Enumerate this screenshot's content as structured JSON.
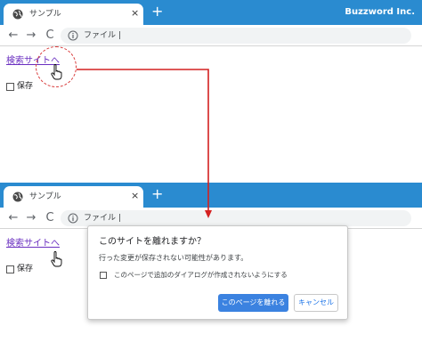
{
  "top_window": {
    "tab": {
      "title": "サンプル",
      "close": "×"
    },
    "new_tab": "+",
    "brand": "Buzzword Inc.",
    "toolbar": {
      "back": "←",
      "forward": "→",
      "reload": "C",
      "url": "ファイル |"
    },
    "content": {
      "search_link": "検索サイトへ",
      "checkbox_label": "保存"
    }
  },
  "bottom_window": {
    "tab": {
      "title": "サンプル",
      "close": "×"
    },
    "new_tab": "+",
    "toolbar": {
      "back": "←",
      "forward": "→",
      "reload": "C",
      "url": "ファイル |"
    },
    "content": {
      "search_link": "検索サイトへ",
      "checkbox_label": "保存"
    }
  },
  "dialog": {
    "title": "このサイトを離れますか？",
    "message": "行った変更が保存されない可能性があります。",
    "checkbox_label": "このページで追加のダイアログが作成されないようにする",
    "leave_button": "このページを離れる",
    "cancel_button": "キャンセル"
  },
  "colors": {
    "tabstrip": "#2a8bd0",
    "link": "#6a2fc0",
    "highlight": "#d83a3a",
    "arrow": "#d42020",
    "primary_button": "#3b82e0"
  },
  "icons": [
    "globe-icon",
    "close-icon",
    "plus-icon",
    "back-arrow-icon",
    "forward-arrow-icon",
    "reload-icon",
    "info-icon",
    "hand-cursor-icon"
  ]
}
